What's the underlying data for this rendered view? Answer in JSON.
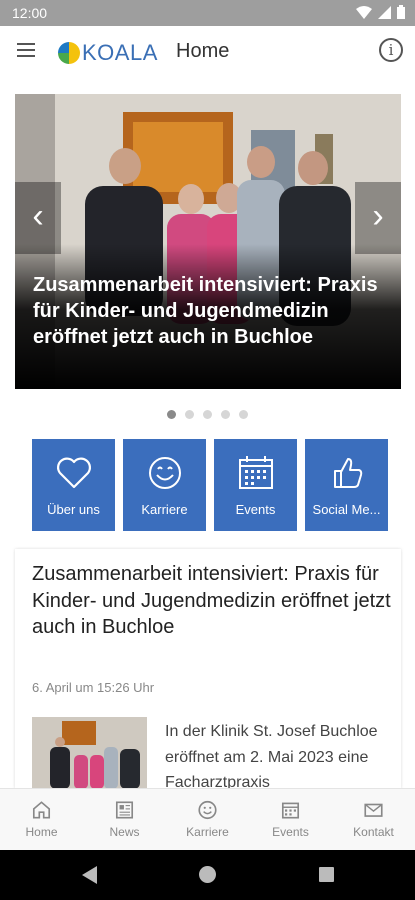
{
  "status": {
    "time": "12:00"
  },
  "appbar": {
    "logo_text": "KOALA",
    "title": "Home",
    "info_glyph": "i"
  },
  "carousel": {
    "caption": "Zusammenarbeit intensiviert: Praxis für Kinder- und Jugendmedizin eröffnet jetzt auch in Buchloe",
    "prev_glyph": "‹",
    "next_glyph": "›",
    "slide_count": 5,
    "active_index": 0
  },
  "tiles": [
    {
      "label": "Über uns",
      "icon": "heart-icon"
    },
    {
      "label": "Karriere",
      "icon": "smiley-icon"
    },
    {
      "label": "Events",
      "icon": "calendar-icon"
    },
    {
      "label": "Social Me...",
      "icon": "thumbs-up-icon"
    }
  ],
  "article": {
    "title": "Zusammenarbeit intensiviert: Praxis für Kinder- und Jugendmedizin eröffnet jetzt auch in Buchloe",
    "date": "6. April um 15:26 Uhr",
    "excerpt": "In der Klinik St. Josef Buchloe eröffnet am 2. Mai 2023 eine Facharztpraxis"
  },
  "bottom_nav": [
    {
      "label": "Home",
      "icon": "home-icon"
    },
    {
      "label": "News",
      "icon": "news-icon"
    },
    {
      "label": "Karriere",
      "icon": "smiley-icon"
    },
    {
      "label": "Events",
      "icon": "calendar-icon"
    },
    {
      "label": "Kontakt",
      "icon": "mail-icon"
    }
  ],
  "colors": {
    "accent": "#3b6ebd",
    "statusbar": "#9e9e9e",
    "logo": "#3a6fb5"
  }
}
